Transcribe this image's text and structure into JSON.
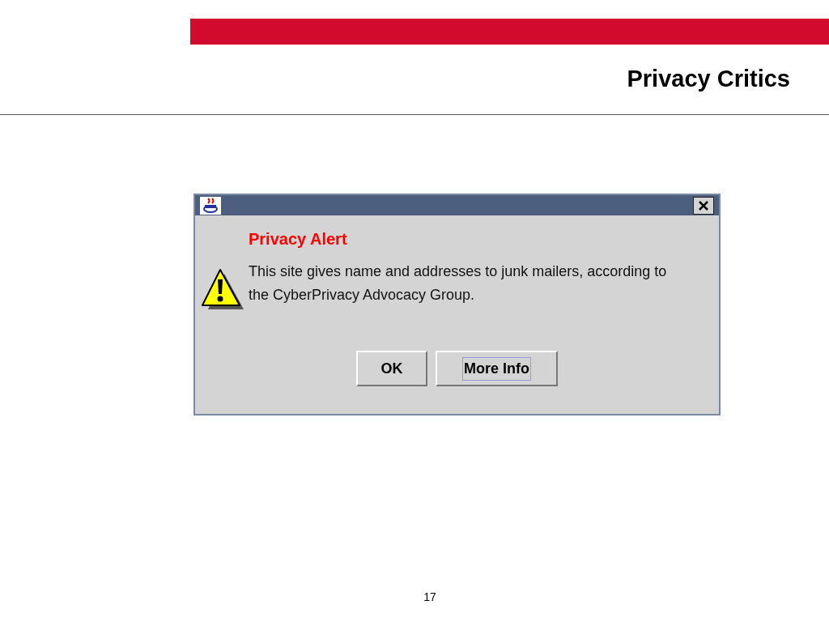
{
  "slide": {
    "title": "Privacy Critics",
    "page_number": "17"
  },
  "dialog": {
    "heading": "Privacy Alert",
    "message": "This site gives name and addresses to junk mailers, according to the CyberPrivacy Advocacy Group.",
    "buttons": [
      {
        "label": "OK",
        "focused": false
      },
      {
        "label": "More Info",
        "focused": true
      }
    ]
  }
}
